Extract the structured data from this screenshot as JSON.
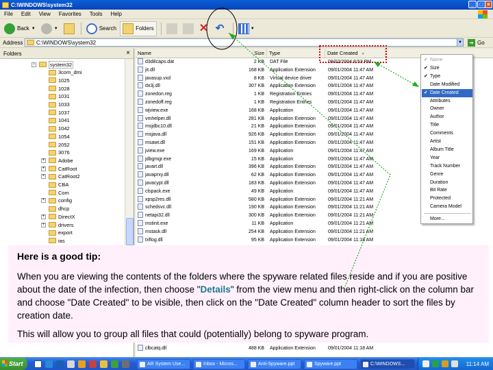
{
  "window": {
    "title": "C:\\WINDOWS\\system32"
  },
  "menu": [
    "File",
    "Edit",
    "View",
    "Favorites",
    "Tools",
    "Help"
  ],
  "toolbar": {
    "back_label": "Back",
    "search_label": "Search",
    "folders_label": "Folders"
  },
  "address": {
    "label": "Address",
    "value": "C:\\WINDOWS\\system32",
    "go_label": "Go"
  },
  "folders_pane": {
    "title": "Folders",
    "close": "×",
    "items": [
      {
        "label": "system32",
        "expander": "−"
      },
      {
        "label": "3com_dmi",
        "expander": ""
      },
      {
        "label": "1025",
        "expander": ""
      },
      {
        "label": "1028",
        "expander": ""
      },
      {
        "label": "1031",
        "expander": ""
      },
      {
        "label": "1033",
        "expander": ""
      },
      {
        "label": "1037",
        "expander": ""
      },
      {
        "label": "1041",
        "expander": ""
      },
      {
        "label": "1042",
        "expander": ""
      },
      {
        "label": "1054",
        "expander": ""
      },
      {
        "label": "2052",
        "expander": ""
      },
      {
        "label": "3076",
        "expander": ""
      },
      {
        "label": "Adobe",
        "expander": "+"
      },
      {
        "label": "CatRoot",
        "expander": "+"
      },
      {
        "label": "CatRoot2",
        "expander": "+"
      },
      {
        "label": "CBA",
        "expander": ""
      },
      {
        "label": "Com",
        "expander": ""
      },
      {
        "label": "config",
        "expander": "+"
      },
      {
        "label": "dhcp",
        "expander": ""
      },
      {
        "label": "DirectX",
        "expander": "+"
      },
      {
        "label": "drivers",
        "expander": "+"
      },
      {
        "label": "export",
        "expander": ""
      },
      {
        "label": "ias",
        "expander": ""
      }
    ]
  },
  "file_list": {
    "columns": {
      "name": "Name",
      "size": "Size",
      "type": "Type",
      "date": "Date Created",
      "sort_glyph": "▼"
    },
    "rows": [
      {
        "name": "d3d8caps.dat",
        "size": "2 KB",
        "type": "DAT File",
        "date": "09/02/2004 8:53 PM"
      },
      {
        "name": "jit.dll",
        "size": "168 KB",
        "type": "Application Extension",
        "date": "09/01/2004 11:47 AM"
      },
      {
        "name": "javasup.vxd",
        "size": "8 KB",
        "type": "Virtual device driver",
        "date": "09/01/2004 11:47 AM"
      },
      {
        "name": "dx3j.dll",
        "size": "307 KB",
        "type": "Application Extension",
        "date": "09/01/2004 11:47 AM"
      },
      {
        "name": "zonedon.reg",
        "size": "1 KB",
        "type": "Registration Entries",
        "date": "09/01/2004 11:47 AM"
      },
      {
        "name": "zonedoff.reg",
        "size": "1 KB",
        "type": "Registration Entries",
        "date": "09/01/2004 11:47 AM"
      },
      {
        "name": "wjview.exe",
        "size": "168 KB",
        "type": "Application",
        "date": "09/01/2004 11:47 AM"
      },
      {
        "name": "vmhelper.dll",
        "size": "281 KB",
        "type": "Application Extension",
        "date": "09/01/2004 11:47 AM"
      },
      {
        "name": "msjdbc10.dll",
        "size": "21 KB",
        "type": "Application Extension",
        "date": "09/01/2004 11:47 AM"
      },
      {
        "name": "msjava.dll",
        "size": "926 KB",
        "type": "Application Extension",
        "date": "09/01/2004 11:47 AM"
      },
      {
        "name": "msawt.dll",
        "size": "151 KB",
        "type": "Application Extension",
        "date": "09/01/2004 11:47 AM"
      },
      {
        "name": "jview.exe",
        "size": "169 KB",
        "type": "Application",
        "date": "09/01/2004 11:47 AM"
      },
      {
        "name": "jdbgmgr.exe",
        "size": "15 KB",
        "type": "Application",
        "date": "09/01/2004 11:47 AM"
      },
      {
        "name": "javart.dll",
        "size": "396 KB",
        "type": "Application Extension",
        "date": "09/01/2004 11:47 AM"
      },
      {
        "name": "javaprxy.dll",
        "size": "62 KB",
        "type": "Application Extension",
        "date": "09/01/2004 11:47 AM"
      },
      {
        "name": "javacypt.dll",
        "size": "183 KB",
        "type": "Application Extension",
        "date": "09/01/2004 11:47 AM"
      },
      {
        "name": "clspack.exe",
        "size": "49 KB",
        "type": "Application",
        "date": "09/01/2004 11:47 AM"
      },
      {
        "name": "xpsp2res.dll",
        "size": "580 KB",
        "type": "Application Extension",
        "date": "09/01/2004 11:21 AM"
      },
      {
        "name": "schedsvc.dll",
        "size": "190 KB",
        "type": "Application Extension",
        "date": "09/01/2004 11:21 AM"
      },
      {
        "name": "netapi32.dll",
        "size": "300 KB",
        "type": "Application Extension",
        "date": "09/01/2004 11:21 AM"
      },
      {
        "name": "mstinit.exe",
        "size": "11 KB",
        "type": "Application",
        "date": "09/01/2004 11:21 AM"
      },
      {
        "name": "mstask.dll",
        "size": "254 KB",
        "type": "Application Extension",
        "date": "09/01/2004 11:21 AM"
      },
      {
        "name": "txflog.dll",
        "size": "95 KB",
        "type": "Application Extension",
        "date": "09/01/2004 11:18 AM"
      }
    ],
    "bottom_row": {
      "name": "clbcatq.dll",
      "size": "488 KB",
      "type": "Application Extension",
      "date": "09/01/2004 11:18 AM"
    }
  },
  "context_menu": {
    "items": [
      {
        "label": "Name",
        "check": "✔",
        "state": "disabled"
      },
      {
        "label": "Size",
        "check": "✔",
        "state": "normal"
      },
      {
        "label": "Type",
        "check": "✔",
        "state": "normal"
      },
      {
        "label": "Date Modified",
        "check": "",
        "state": "normal"
      },
      {
        "label": "Date Created",
        "check": "✔",
        "state": "selected"
      },
      {
        "label": "Attributes",
        "check": "",
        "state": "normal"
      },
      {
        "label": "Owner",
        "check": "",
        "state": "normal"
      },
      {
        "label": "Author",
        "check": "",
        "state": "normal"
      },
      {
        "label": "Title",
        "check": "",
        "state": "normal"
      },
      {
        "label": "Comments",
        "check": "",
        "state": "normal"
      },
      {
        "label": "Artist",
        "check": "",
        "state": "normal"
      },
      {
        "label": "Album Title",
        "check": "",
        "state": "normal"
      },
      {
        "label": "Year",
        "check": "",
        "state": "normal"
      },
      {
        "label": "Track Number",
        "check": "",
        "state": "normal"
      },
      {
        "label": "Genre",
        "check": "",
        "state": "normal"
      },
      {
        "label": "Duration",
        "check": "",
        "state": "normal"
      },
      {
        "label": "Bit Rate",
        "check": "",
        "state": "normal"
      },
      {
        "label": "Protected",
        "check": "",
        "state": "normal"
      },
      {
        "label": "Camera Model",
        "check": "",
        "state": "normal"
      }
    ],
    "more": "More..."
  },
  "tip": {
    "title": "Here is a good tip:",
    "p1_before": "When you are viewing the contents of the folders where the spyware related files reside and if you are positive about the date of the infection, then choose \"",
    "p1_highlight": "Details",
    "p1_after": "\" from the view menu and then right-click on the column bar and choose \"Date Created\" to be visible, then click on the \"Date Created\" column header to sort the files by creation date.",
    "p2": "This will allow you to group all files that could (potentially) belong to spyware program."
  },
  "taskbar": {
    "start": "Start",
    "tasks": [
      "AR System Use...",
      "Inbox - Micros...",
      "Anti-Spyware.ppt",
      "Spyware.ppt",
      "C:\\WINDOWS..."
    ],
    "clock": "11:14 AM"
  },
  "colors": {
    "highlight": "#316ac5",
    "annotation_red": "#cc0000",
    "annotation_green": "#22aa22",
    "tip_bg": "#fff0fb",
    "tip_accent": "#1a7a8a"
  }
}
